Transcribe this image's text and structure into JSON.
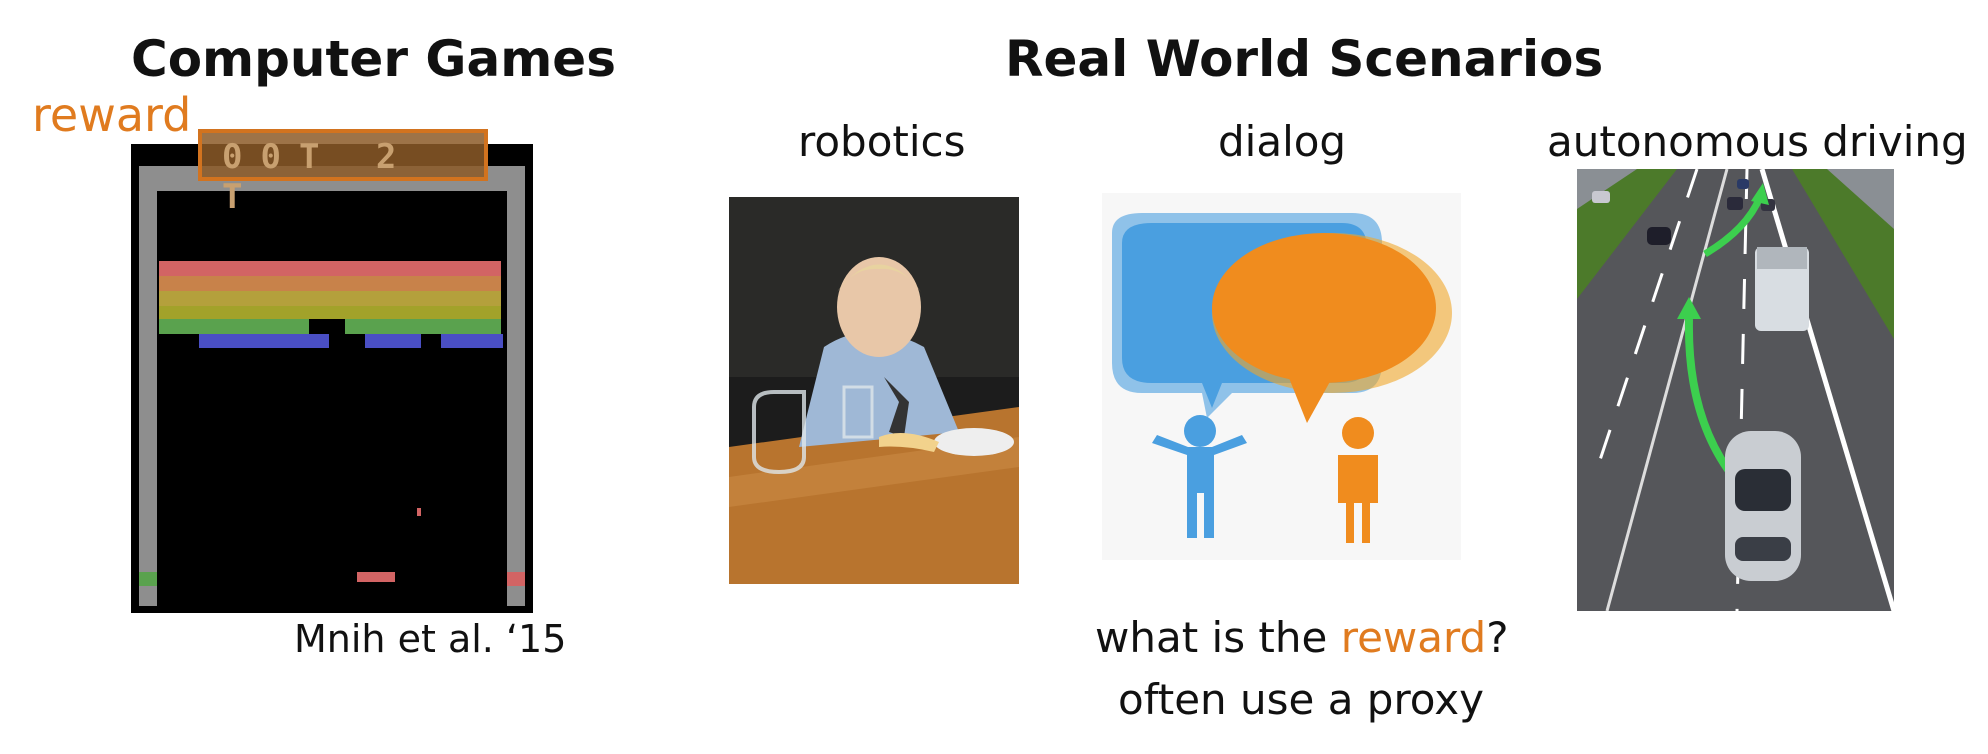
{
  "headings": {
    "games": "Computer Games",
    "real_world": "Real World Scenarios"
  },
  "labels": {
    "reward": "reward",
    "robotics": "robotics",
    "dialog": "dialog",
    "driving": "autonomous driving"
  },
  "game": {
    "score_text": "00T 2 T",
    "citation": "Mnih et al. ‘15"
  },
  "question": {
    "prefix": "what is the ",
    "highlight": "reward",
    "suffix": "?",
    "line2": "often use a proxy"
  },
  "colors": {
    "accent": "#e07b1f",
    "blue_bubble": "#4a9fe0",
    "orange_bubble": "#f08c1e",
    "green_arrow": "#3ccf4e"
  },
  "icons": {
    "game": "breakout-screenshot",
    "robotics": "child-at-table-photo",
    "dialog": "speech-bubbles-icon",
    "driving": "highway-car-photo"
  }
}
